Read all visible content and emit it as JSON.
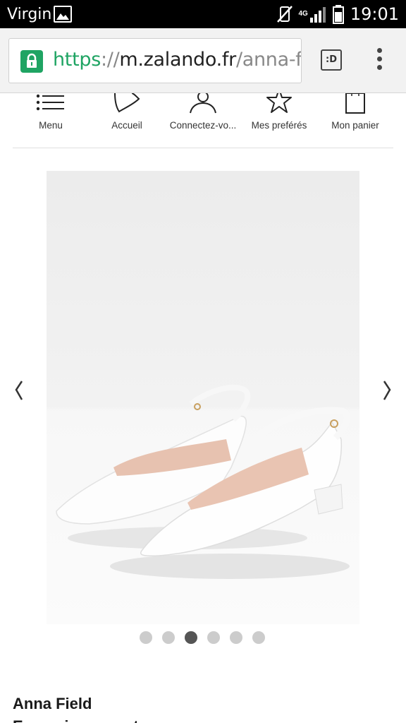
{
  "status_bar": {
    "carrier": "Virgin",
    "network_type": "4G",
    "time": "19:01",
    "icons": [
      "gallery-icon",
      "vibrate-off-icon",
      "signal-icon",
      "battery-icon"
    ]
  },
  "browser": {
    "url_scheme": "https",
    "url_separator": "://",
    "url_host": "m.zalando.fr",
    "url_path": "/anna-fi",
    "tabs_label": ":D",
    "accent_color": "#1fa463"
  },
  "nav": {
    "items": [
      {
        "label": "Menu",
        "icon": "menu-icon"
      },
      {
        "label": "Accueil",
        "icon": "home-logo-icon"
      },
      {
        "label": "Connectez-vo...",
        "icon": "user-icon"
      },
      {
        "label": "Mes preférés",
        "icon": "star-icon"
      },
      {
        "label": "Mon panier",
        "icon": "bag-icon"
      }
    ]
  },
  "carousel": {
    "image": "white-slingback-shoes",
    "prev_icon": "chevron-left-icon",
    "next_icon": "chevron-right-icon",
    "dot_count": 6,
    "active_index": 2
  },
  "product": {
    "brand": "Anna Field",
    "name": "Escarpins ouverts"
  }
}
